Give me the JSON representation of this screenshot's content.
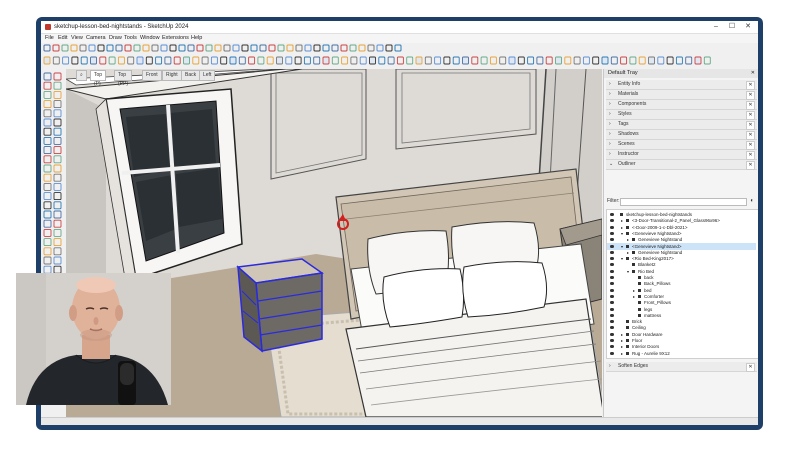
{
  "window": {
    "title": "sketchup-lesson-bed-nightstands - SketchUp 2024",
    "minimize": "–",
    "maximize": "☐",
    "close": "✕"
  },
  "menu": [
    "File",
    "Edit",
    "View",
    "Camera",
    "Draw",
    "Tools",
    "Window",
    "Extensions",
    "Help"
  ],
  "scene_tabs": [
    "Top (P)",
    "Top (PP)",
    "Front",
    "Right",
    "Back",
    "Left"
  ],
  "tray": {
    "title": "Default Tray",
    "panels": [
      "Entity Info",
      "Materials",
      "Components",
      "Styles",
      "Tags",
      "Shadows",
      "Scenes",
      "Instructor",
      "Outliner"
    ],
    "filter_label": "Filter:",
    "bottom_panel": "Soften Edges",
    "outliner": [
      {
        "label": "sketchup-lesson-bed-nightstands",
        "indent": 0,
        "expand": "",
        "selected": false
      },
      {
        "label": "<3-Door-Transitional-2_Panel_Glass96x96>",
        "indent": 1,
        "expand": "▸",
        "selected": false
      },
      {
        "label": "<-Door-2009-1-c-Dbl-2021>",
        "indent": 1,
        "expand": "▸",
        "selected": false
      },
      {
        "label": "<Genevieve Nightstand>",
        "indent": 1,
        "expand": "▾",
        "selected": false
      },
      {
        "label": "Genevieve Nightstand",
        "indent": 2,
        "expand": "▸",
        "selected": false
      },
      {
        "label": "<Genevieve Nightstand>",
        "indent": 1,
        "expand": "▾",
        "selected": true
      },
      {
        "label": "Genevieve Nightstand",
        "indent": 2,
        "expand": "▸",
        "selected": false
      },
      {
        "label": "<Rio Bed-King2017>",
        "indent": 1,
        "expand": "▾",
        "selected": false
      },
      {
        "label": "Blanket2",
        "indent": 2,
        "expand": "",
        "selected": false
      },
      {
        "label": "Rio Bed",
        "indent": 2,
        "expand": "▾",
        "selected": false
      },
      {
        "label": "back",
        "indent": 3,
        "expand": "",
        "selected": false
      },
      {
        "label": "Back_Pillows",
        "indent": 3,
        "expand": "",
        "selected": false
      },
      {
        "label": "bed",
        "indent": 3,
        "expand": "▸",
        "selected": false
      },
      {
        "label": "Comforter",
        "indent": 3,
        "expand": "▸",
        "selected": false
      },
      {
        "label": "Front_Pillows",
        "indent": 3,
        "expand": "",
        "selected": false
      },
      {
        "label": "legs",
        "indent": 3,
        "expand": "",
        "selected": false
      },
      {
        "label": "mattress",
        "indent": 3,
        "expand": "",
        "selected": false
      },
      {
        "label": "Brick",
        "indent": 1,
        "expand": "",
        "selected": false
      },
      {
        "label": "Ceiling",
        "indent": 1,
        "expand": "",
        "selected": false
      },
      {
        "label": "Door Hardware",
        "indent": 1,
        "expand": "▸",
        "selected": false
      },
      {
        "label": "Floor",
        "indent": 1,
        "expand": "▸",
        "selected": false
      },
      {
        "label": "Interior Doors",
        "indent": 1,
        "expand": "▸",
        "selected": false
      },
      {
        "label": "Rug - Aurelie 9X12",
        "indent": 1,
        "expand": "▸",
        "selected": false
      }
    ]
  },
  "colors": {
    "frame": "#1e3f67",
    "selection": "#2a2adf",
    "wall": "#d9d6d2",
    "highlight": "#cde3f7"
  },
  "icons": {
    "app": "sketchup-logo-icon",
    "search": "search-icon",
    "select": "select-arrow-icon",
    "move_cursor": "rotate-cursor-icon"
  }
}
